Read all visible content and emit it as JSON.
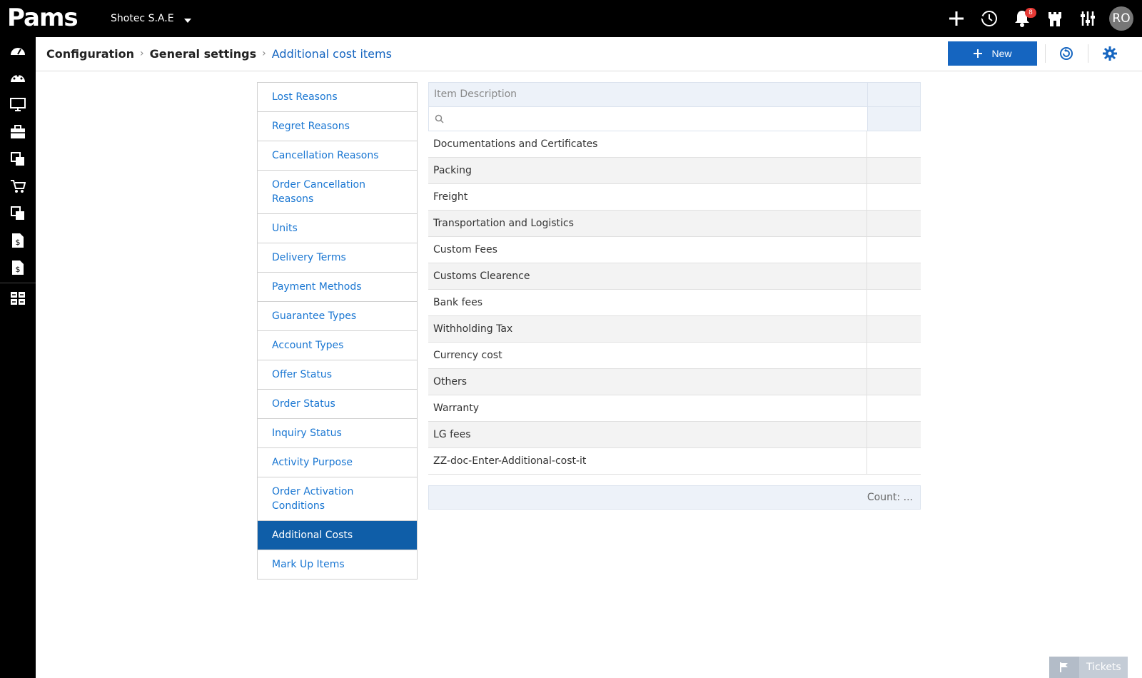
{
  "app": {
    "logo": "Pams",
    "company": "Shotec S.A.E",
    "notifications_count": "8",
    "user_initials": "RO"
  },
  "top_icons": [
    "plus-icon",
    "history-icon",
    "bell-icon",
    "castle-icon",
    "sliders-icon"
  ],
  "sidebar_icons": [
    "dashboard-icon",
    "dashboard-alt-icon",
    "monitor-icon",
    "briefcase-icon",
    "documents-icon",
    "cart-icon",
    "documents-alt-icon",
    "invoice-icon",
    "invoice-alt-icon",
    "grid-settings-icon"
  ],
  "breadcrumb": {
    "level1": "Configuration",
    "level2": "General settings",
    "current": "Additional cost items"
  },
  "toolbar": {
    "new_label": "New"
  },
  "menu": {
    "items": [
      {
        "label": "Lost Reasons"
      },
      {
        "label": "Regret Reasons"
      },
      {
        "label": "Cancellation Reasons"
      },
      {
        "label": "Order Cancellation Reasons"
      },
      {
        "label": "Units"
      },
      {
        "label": "Delivery Terms"
      },
      {
        "label": "Payment Methods"
      },
      {
        "label": "Guarantee Types"
      },
      {
        "label": "Account Types"
      },
      {
        "label": "Offer Status"
      },
      {
        "label": "Order Status"
      },
      {
        "label": "Inquiry Status"
      },
      {
        "label": "Activity Purpose"
      },
      {
        "label": "Order Activation Conditions"
      },
      {
        "label": "Additional Costs"
      },
      {
        "label": "Mark Up Items"
      }
    ],
    "active": "Additional Costs"
  },
  "grid": {
    "column_header": "Item Description",
    "rows": [
      "Documentations and Certificates",
      "Packing",
      "Freight",
      "Transportation and Logistics",
      "Custom Fees",
      "Customs Clearence",
      "Bank fees",
      "Withholding Tax",
      "Currency cost",
      "Others",
      "Warranty",
      "LG fees",
      "ZZ-doc-Enter-Additional-cost-it"
    ],
    "footer": "Count: ..."
  },
  "tickets": {
    "label": "Tickets"
  },
  "colors": {
    "accent": "#1565c0",
    "topbar": "#000000",
    "active_menu": "#0f5ea8"
  }
}
